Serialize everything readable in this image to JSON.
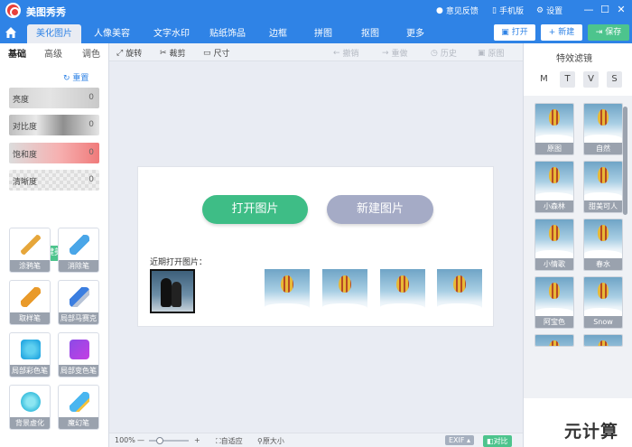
{
  "app": {
    "title": "美图秀秀"
  },
  "titlebar": {
    "feedback": "意见反馈",
    "mobile": "手机版",
    "settings": "设置"
  },
  "nav": {
    "tabs": [
      "美化图片",
      "人像美容",
      "文字水印",
      "贴纸饰品",
      "边框",
      "拼图",
      "抠图",
      "更多"
    ],
    "active": 0,
    "open": "打开",
    "new": "新建",
    "save": "保存"
  },
  "left": {
    "subtabs": [
      "基础",
      "高级",
      "调色"
    ],
    "reset": "重置",
    "sliders": [
      {
        "label": "亮度",
        "value": "0"
      },
      {
        "label": "对比度",
        "value": "0"
      },
      {
        "label": "饱和度",
        "value": "0"
      },
      {
        "label": "清晰度",
        "value": "0"
      }
    ],
    "one_click": "一键美化",
    "tools": [
      "涂鸦笔",
      "消除笔",
      "取样笔",
      "局部马赛克",
      "局部彩色笔",
      "局部变色笔",
      "背景虚化",
      "魔幻笔"
    ]
  },
  "toolbar": {
    "rotate": "旋转",
    "crop": "裁剪",
    "resize": "尺寸",
    "undo": "撤销",
    "redo": "重做",
    "history": "历史",
    "original": "原图"
  },
  "canvas": {
    "open_image": "打开图片",
    "new_image": "新建图片",
    "recent_label": "近期打开图片："
  },
  "bottom": {
    "zoom": "100%",
    "fit": "自适应",
    "actual": "原大小",
    "exif": "EXIF",
    "compare": "对比"
  },
  "right": {
    "title": "特效滤镜",
    "tabs": [
      "M",
      "T",
      "V",
      "S"
    ],
    "filters": [
      "原图",
      "自然",
      "小森林",
      "甜美可人",
      "小情歌",
      "春水",
      "阿宝色",
      "Snow"
    ]
  },
  "watermark": "元计算",
  "colors": {
    "brand_blue": "#2f83e6",
    "green": "#3ebd86",
    "gray_button": "#a5abc6"
  }
}
